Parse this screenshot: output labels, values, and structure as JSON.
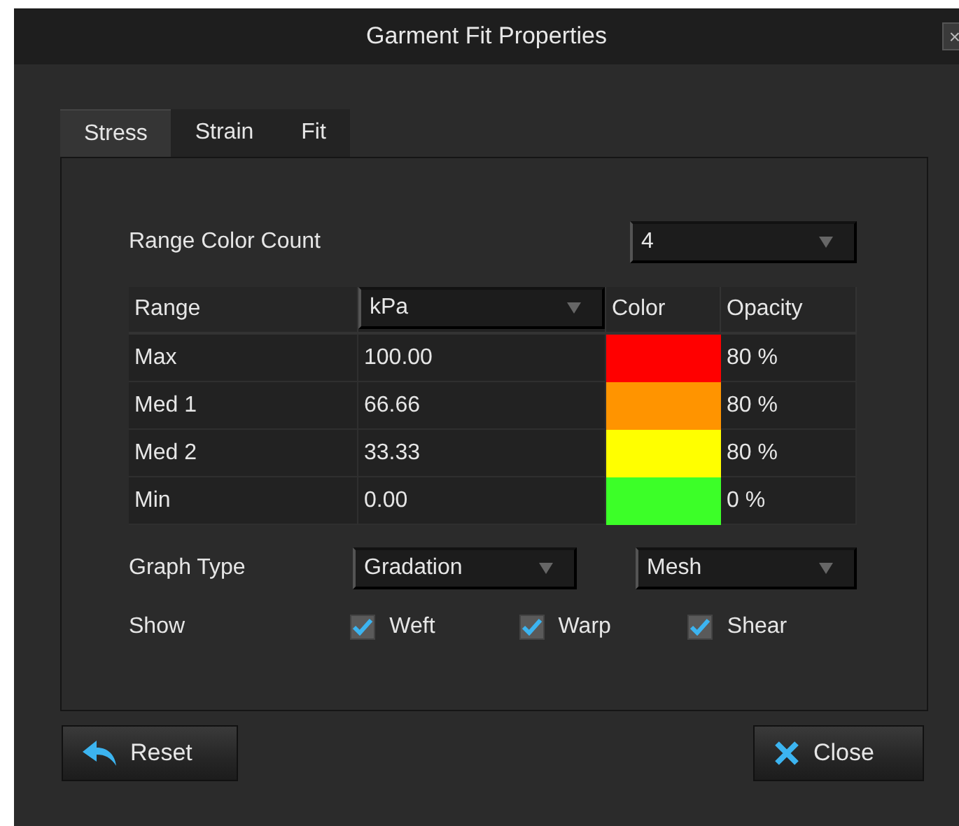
{
  "window": {
    "title": "Garment Fit Properties",
    "close": "×"
  },
  "tabs": [
    {
      "label": "Stress",
      "selected": true
    },
    {
      "label": "Strain",
      "selected": false
    },
    {
      "label": "Fit",
      "selected": false
    }
  ],
  "range_color_count": {
    "label": "Range Color Count",
    "value": "4"
  },
  "table": {
    "columns": [
      {
        "label": "Range",
        "kind": "text"
      },
      {
        "label": "kPa",
        "kind": "dropdown"
      },
      {
        "label": "Color",
        "kind": "text"
      },
      {
        "label": "Opacity",
        "kind": "text"
      }
    ],
    "rows": [
      {
        "range": "Max",
        "value": "100.00",
        "color": "#ff0000",
        "opacity": "80 %"
      },
      {
        "range": "Med 1",
        "value": "66.66",
        "color": "#ff9400",
        "opacity": "80 %"
      },
      {
        "range": "Med 2",
        "value": "33.33",
        "color": "#ffff00",
        "opacity": "80 %"
      },
      {
        "range": "Min",
        "value": "0.00",
        "color": "#3cff28",
        "opacity": "0 %"
      }
    ]
  },
  "graph_type": {
    "label": "Graph Type",
    "dropdowns": [
      "Gradation",
      "Mesh"
    ]
  },
  "show": {
    "label": "Show",
    "options": [
      {
        "label": "Weft",
        "checked": true
      },
      {
        "label": "Warp",
        "checked": true
      },
      {
        "label": "Shear",
        "checked": true
      }
    ]
  },
  "buttons": [
    {
      "label": "Reset",
      "kind": "reset"
    },
    {
      "label": "Close",
      "kind": "close"
    }
  ]
}
